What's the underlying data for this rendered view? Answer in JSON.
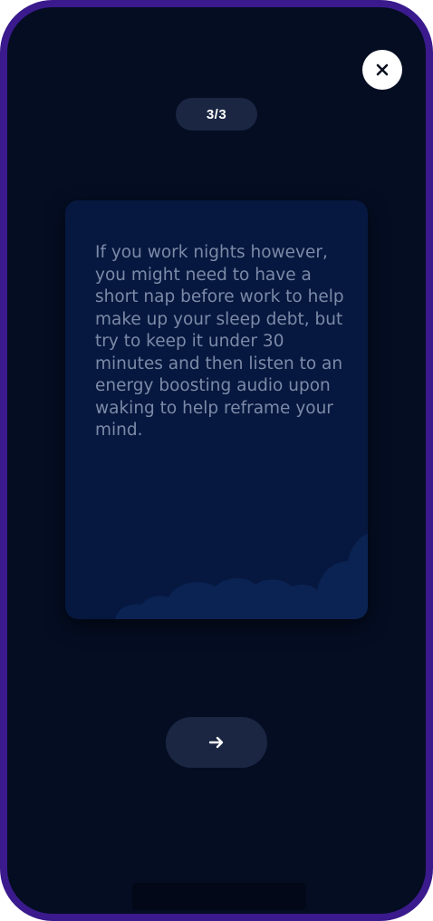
{
  "progress": {
    "label": "3/3"
  },
  "card": {
    "text": "If you work nights however, you might need to have a short nap before work to help make up your sleep debt, but try to keep it under 30 minutes and then listen to an energy boosting audio upon waking to help reframe your mind."
  },
  "icons": {
    "close": "close-icon",
    "next": "arrow-right-icon"
  },
  "colors": {
    "frame": "#3a1a8c",
    "background": "#040d22",
    "card": "#06183f",
    "pill": "#1a2642",
    "text": "#7c8aa8"
  }
}
